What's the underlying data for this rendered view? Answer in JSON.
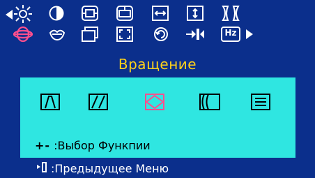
{
  "osd": {
    "title": "Вращение",
    "nav": {
      "prev_arrow": "◀",
      "next_arrow": "▶"
    },
    "top_icons_row1": [
      "brightness-icon",
      "contrast-icon",
      "h-size-icon",
      "v-size-icon",
      "h-position-icon",
      "v-position-icon",
      "pincushion-icon"
    ],
    "top_icons_row2": [
      "rotation-icon",
      "degauss-icon",
      "language-icon",
      "zoom-icon",
      "recall-icon",
      "moire-icon",
      "frequency-icon"
    ],
    "selected_icon": "rotation-icon",
    "sub_icons": [
      "trapezoid-icon",
      "parallelogram-icon",
      "rotation-tilt-icon",
      "pin-balance-icon",
      "linearity-icon"
    ],
    "selected_sub_icon": "rotation-tilt-icon",
    "freq_label": "Hz",
    "hint_select_keys": "+-",
    "hint_select_text": ":Выбор Функпии",
    "hint_menu_text": ":Предыдущее Меню",
    "colors": {
      "background": "#0b2f8c",
      "panel": "#2fe6e1",
      "title": "#ffd21a",
      "selected": "#ff4f8e"
    }
  }
}
